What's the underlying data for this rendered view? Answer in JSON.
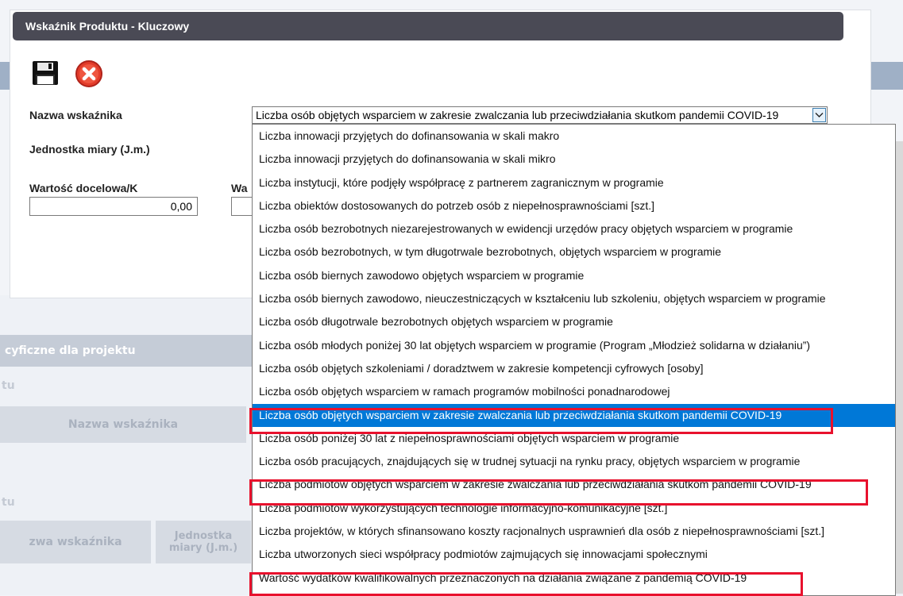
{
  "dialog": {
    "title": "Wskaźnik Produktu - Kluczowy",
    "toolbar": {
      "save_icon": "floppy-disk-icon",
      "close_icon": "close-x-icon"
    }
  },
  "form": {
    "name_label": "Nazwa wskaźnika",
    "unit_label": "Jednostka miary (J.m.)",
    "target_label": "Wartość docelowa/K",
    "second_label_partial": "Wa",
    "target_value": "0,00",
    "selected_value": "Liczba osób objętych wsparciem w zakresie zwalczania lub przeciwdziałania skutkom pandemii COVID-19"
  },
  "dropdown": {
    "options": [
      "Liczba innowacji przyjętych do dofinansowania w skali makro",
      "Liczba innowacji przyjętych do dofinansowania w skali mikro",
      "Liczba instytucji, które podjęły współpracę z partnerem zagranicznym w programie",
      "Liczba obiektów dostosowanych do potrzeb osób z niepełnosprawnościami [szt.]",
      "Liczba osób bezrobotnych niezarejestrowanych w ewidencji urzędów pracy objętych wsparciem w programie",
      "Liczba osób bezrobotnych, w tym długotrwale bezrobotnych, objętych wsparciem w programie",
      "Liczba osób biernych zawodowo objętych wsparciem w programie",
      "Liczba osób biernych zawodowo, nieuczestniczących w kształceniu lub szkoleniu, objętych wsparciem w programie",
      "Liczba osób długotrwale bezrobotnych objętych wsparciem w programie",
      "Liczba osób młodych poniżej 30 lat objętych wsparciem w programie (Program „Młodzież solidarna w działaniu”)",
      "Liczba osób objętych szkoleniami / doradztwem w zakresie kompetencji cyfrowych [osoby]",
      "Liczba osób objętych wsparciem w ramach programów mobilności ponadnarodowej",
      "Liczba osób objętych wsparciem w zakresie zwalczania lub przeciwdziałania skutkom pandemii COVID-19",
      "Liczba osób poniżej 30 lat z niepełnosprawnościami objętych wsparciem w programie",
      "Liczba osób pracujących, znajdujących się w trudnej sytuacji na rynku pracy, objętych wsparciem w programie",
      "Liczba podmiotów objętych wsparciem w zakresie zwalczania lub przeciwdziałania skutkom pandemii COVID-19",
      "Liczba podmiotów wykorzystujących technologie informacyjno-komunikacyjne [szt.]",
      "Liczba projektów, w których sfinansowano koszty racjonalnych usprawnień dla osób z niepełnosprawnościami [szt.]",
      "Liczba utworzonych sieci współpracy podmiotów zajmujących się innowacjami społecznymi",
      "Wartość wydatków kwalifikowalnych przeznaczonych na działania związane z pandemią COVID-19"
    ],
    "selected_index": 12,
    "highlighted_indices": [
      12,
      15,
      19
    ],
    "highlight_color": "#e8112d",
    "selection_color": "#0078d7"
  },
  "background": {
    "section_title": "cyficzne dla projektu",
    "label_tu_1": "tu",
    "header_name": "Nazwa wskaźnika",
    "label_tu_2": "tu",
    "header_name_2": "zwa wskaźnika",
    "header_unit": "Jednostka miary (J.m.)"
  }
}
